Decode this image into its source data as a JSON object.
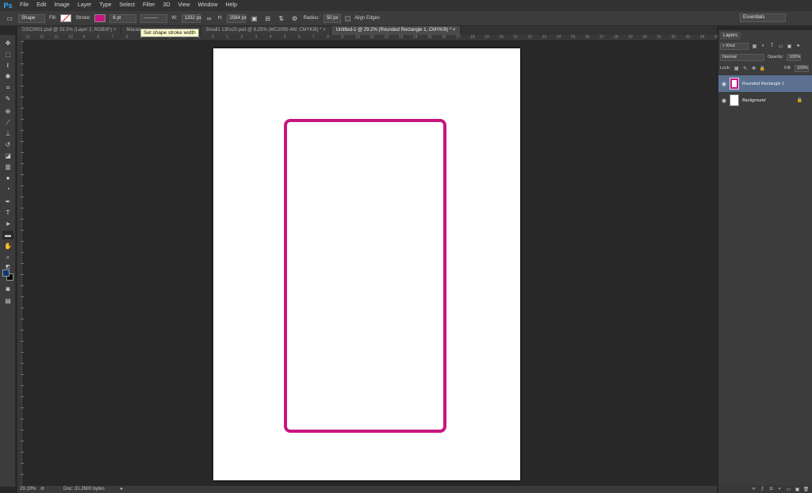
{
  "app": {
    "logo": "Ps"
  },
  "menu": [
    "File",
    "Edit",
    "Image",
    "Layer",
    "Type",
    "Select",
    "Filter",
    "3D",
    "View",
    "Window",
    "Help"
  ],
  "options": {
    "mode": "Shape",
    "fill_label": "Fill:",
    "stroke_label": "Stroke:",
    "stroke_color": "#c8167f",
    "stroke_width": "6 pt",
    "w_label": "W:",
    "w_value": "1332 px",
    "h_label": "H:",
    "h_value": "2564 px",
    "radius_label": "Radius:",
    "radius_value": "50 px",
    "align_edges": "Align Edges",
    "workspace": "Essentials"
  },
  "tooltip": "Set shape stroke width",
  "tabs": [
    {
      "label": "DSC0001.psd @ 33.3% (Layer 2, RGB/8*)",
      "close": "×"
    },
    {
      "label": "Macau",
      "close": ""
    },
    {
      "label": "Small1 130x20.psd @ 6.25% (MC2095-4W, CMYK/8) *",
      "close": "×"
    },
    {
      "label": "Untitled-1 @ 29.2% (Rounded Rectangle 1, CMYK/8) *",
      "close": "×"
    }
  ],
  "ruler_top": [
    "13",
    "12",
    "11",
    "10",
    "9",
    "8",
    "7",
    "6",
    "5",
    "4",
    "3",
    "2",
    "1",
    "0",
    "1",
    "2",
    "3",
    "4",
    "5",
    "6",
    "7",
    "8",
    "9",
    "10",
    "11",
    "12",
    "13",
    "14",
    "15",
    "16",
    "17",
    "18",
    "19",
    "20",
    "21",
    "22",
    "23",
    "24",
    "25",
    "26",
    "27",
    "28",
    "29",
    "30",
    "31",
    "32",
    "33",
    "34",
    "35"
  ],
  "status": {
    "zoom": "29.19%",
    "doc": "Doc: 31.2M/0 bytes"
  },
  "layers_panel": {
    "tab": "Layers",
    "kind": "Kind",
    "blend": "Normal",
    "opacity_label": "Opacity:",
    "opacity": "100%",
    "lock_label": "Lock:",
    "fill_label": "Fill:",
    "fill": "100%",
    "layers": [
      {
        "name": "Rounded Rectangle 1",
        "selected": true
      },
      {
        "name": "Background",
        "selected": false
      }
    ]
  },
  "colors": {
    "foreground": "#0a3a72",
    "background": "#000000"
  }
}
